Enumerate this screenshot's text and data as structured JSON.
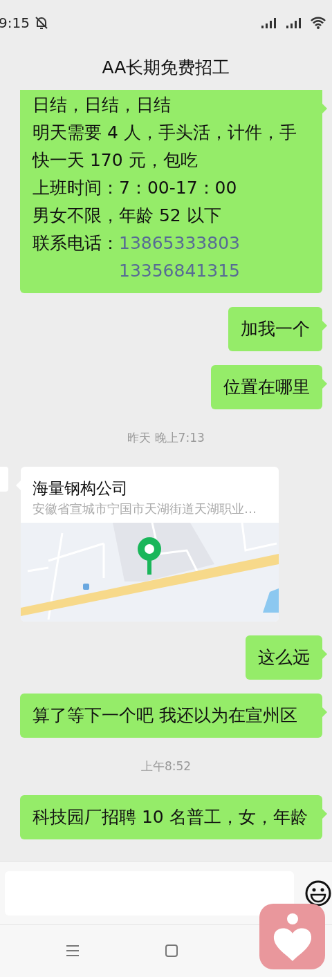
{
  "status_bar": {
    "time": "9:15"
  },
  "header": {
    "title": "AA长期免费招工"
  },
  "messages": [
    {
      "kind": "job_post",
      "outgoing": true,
      "lines": [
        "日结，日结，日结",
        "明天需要 4 人，手头活，计件，手",
        "快一天 170 元，包吃",
        "上班时间：7：00-17：00",
        "男女不限，年龄 52 以下"
      ],
      "contact_label": "联系电话：",
      "phones": [
        "13865333803",
        "13356841315"
      ]
    },
    {
      "kind": "text",
      "outgoing": true,
      "text": "加我一个"
    },
    {
      "kind": "text",
      "outgoing": true,
      "text": "位置在哪里"
    },
    {
      "kind": "time",
      "text": "昨天 晚上7:13"
    },
    {
      "kind": "location",
      "outgoing": false,
      "name": "海量钢构公司",
      "address": "安徽省宣城市宁国市天湖街道天湖职业…"
    },
    {
      "kind": "text",
      "outgoing": true,
      "text": "这么远"
    },
    {
      "kind": "text",
      "outgoing": true,
      "text": "算了等下一个吧 我还以为在宣州区"
    },
    {
      "kind": "time",
      "text": "上午8:52"
    },
    {
      "kind": "text",
      "outgoing": true,
      "text": "科技园厂招聘 10 名普工，女，年龄"
    }
  ]
}
